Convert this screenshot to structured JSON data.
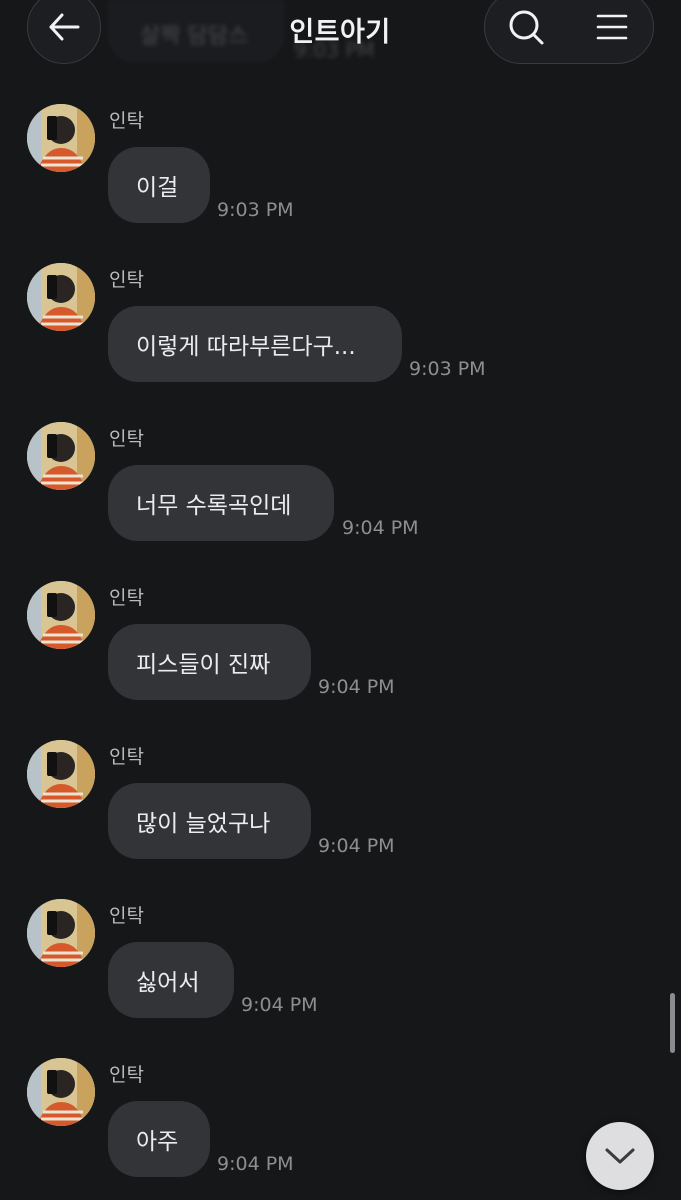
{
  "header": {
    "title": "인트아기",
    "back_icon": "arrow-left-icon",
    "search_icon": "search-icon",
    "menu_icon": "menu-icon",
    "faded_previous_message": "살짝 담담스",
    "faded_previous_time": "9:03 PM"
  },
  "messages": [
    {
      "sender": "인탁",
      "text": "이걸",
      "time": "9:03 PM"
    },
    {
      "sender": "인탁",
      "text": "이렇게 따라부른다구...",
      "time": "9:03 PM"
    },
    {
      "sender": "인탁",
      "text": "너무 수록곡인데",
      "time": "9:04 PM"
    },
    {
      "sender": "인탁",
      "text": "피스들이 진짜",
      "time": "9:04 PM"
    },
    {
      "sender": "인탁",
      "text": "많이 늘었구나",
      "time": "9:04 PM"
    },
    {
      "sender": "인탁",
      "text": "싫어서",
      "time": "9:04 PM"
    },
    {
      "sender": "인탁",
      "text": "아주",
      "time": "9:04 PM"
    }
  ],
  "scroll_down_icon": "chevron-down-icon",
  "colors": {
    "background": "#161719",
    "bubble": "#333438",
    "timestamp": "#8d8e92",
    "fab": "#dedee0"
  }
}
